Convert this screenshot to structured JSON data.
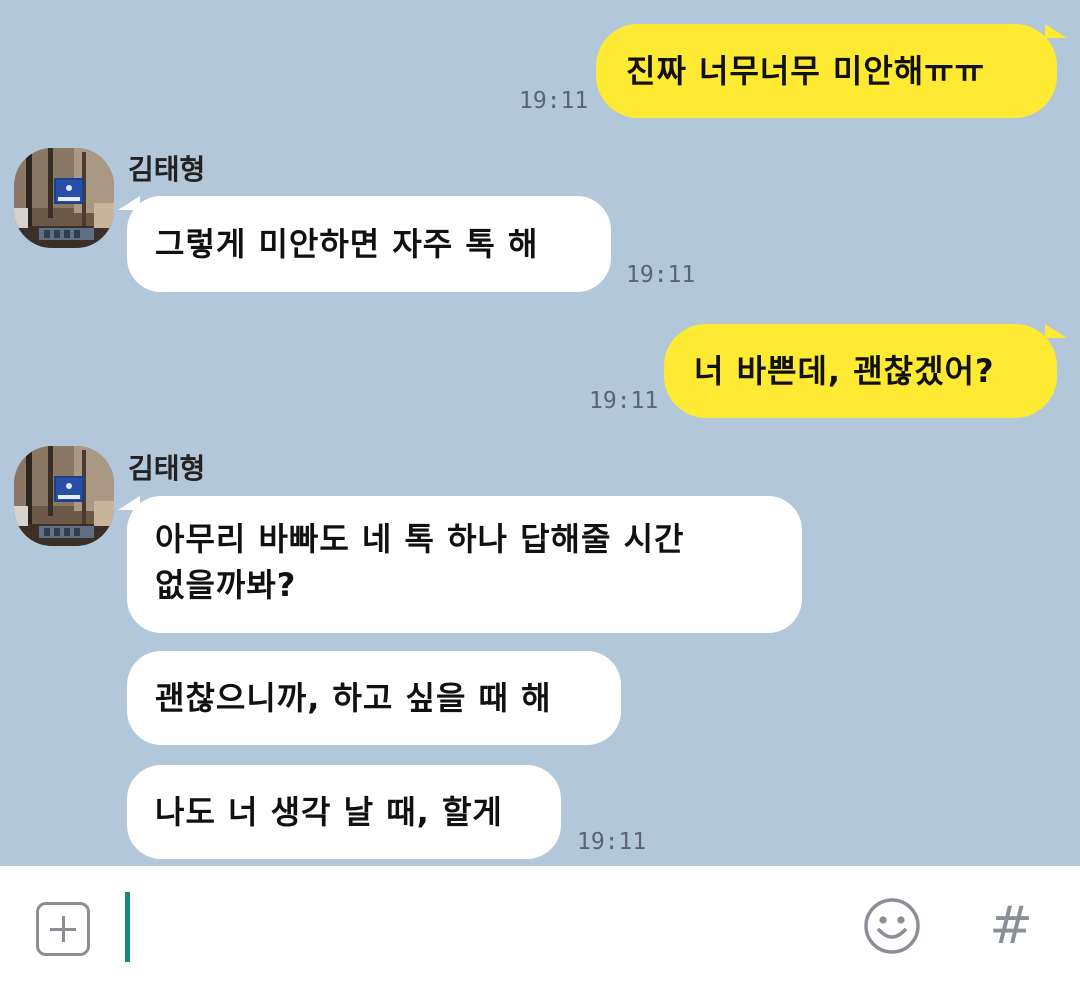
{
  "messages": [
    {
      "id": "m1",
      "from": "me",
      "text": "진짜 너무너무 미안해ㅠㅠ",
      "time": "19:11"
    },
    {
      "id": "m2",
      "from": "김태형",
      "sender": "김태형",
      "text": "그렇게 미안하면 자주 톡 해",
      "time": "19:11"
    },
    {
      "id": "m3",
      "from": "me",
      "text": "너 바쁜데, 괜찮겠어?",
      "time": "19:11"
    },
    {
      "id": "m4",
      "from": "김태형",
      "sender": "김태형",
      "text_line1": "아무리 바빠도 네 톡 하나 답해줄 시간",
      "text_line2": "없을까봐?"
    },
    {
      "id": "m5",
      "from": "김태형",
      "text": "괜찮으니까, 하고 싶을 때 해"
    },
    {
      "id": "m6",
      "from": "김태형",
      "text": "나도 너 생각 날 때, 할게",
      "time": "19:11"
    }
  ],
  "input": {
    "value": "",
    "hash_label": "#"
  },
  "colors": {
    "chat_background": "#b2c7da",
    "my_bubble": "#fee933",
    "their_bubble": "#ffffff",
    "cursor": "#1a8a7a"
  },
  "icons": {
    "attach": "plus-square-icon",
    "emoji": "smiley-icon",
    "hashtag": "hash-icon"
  }
}
